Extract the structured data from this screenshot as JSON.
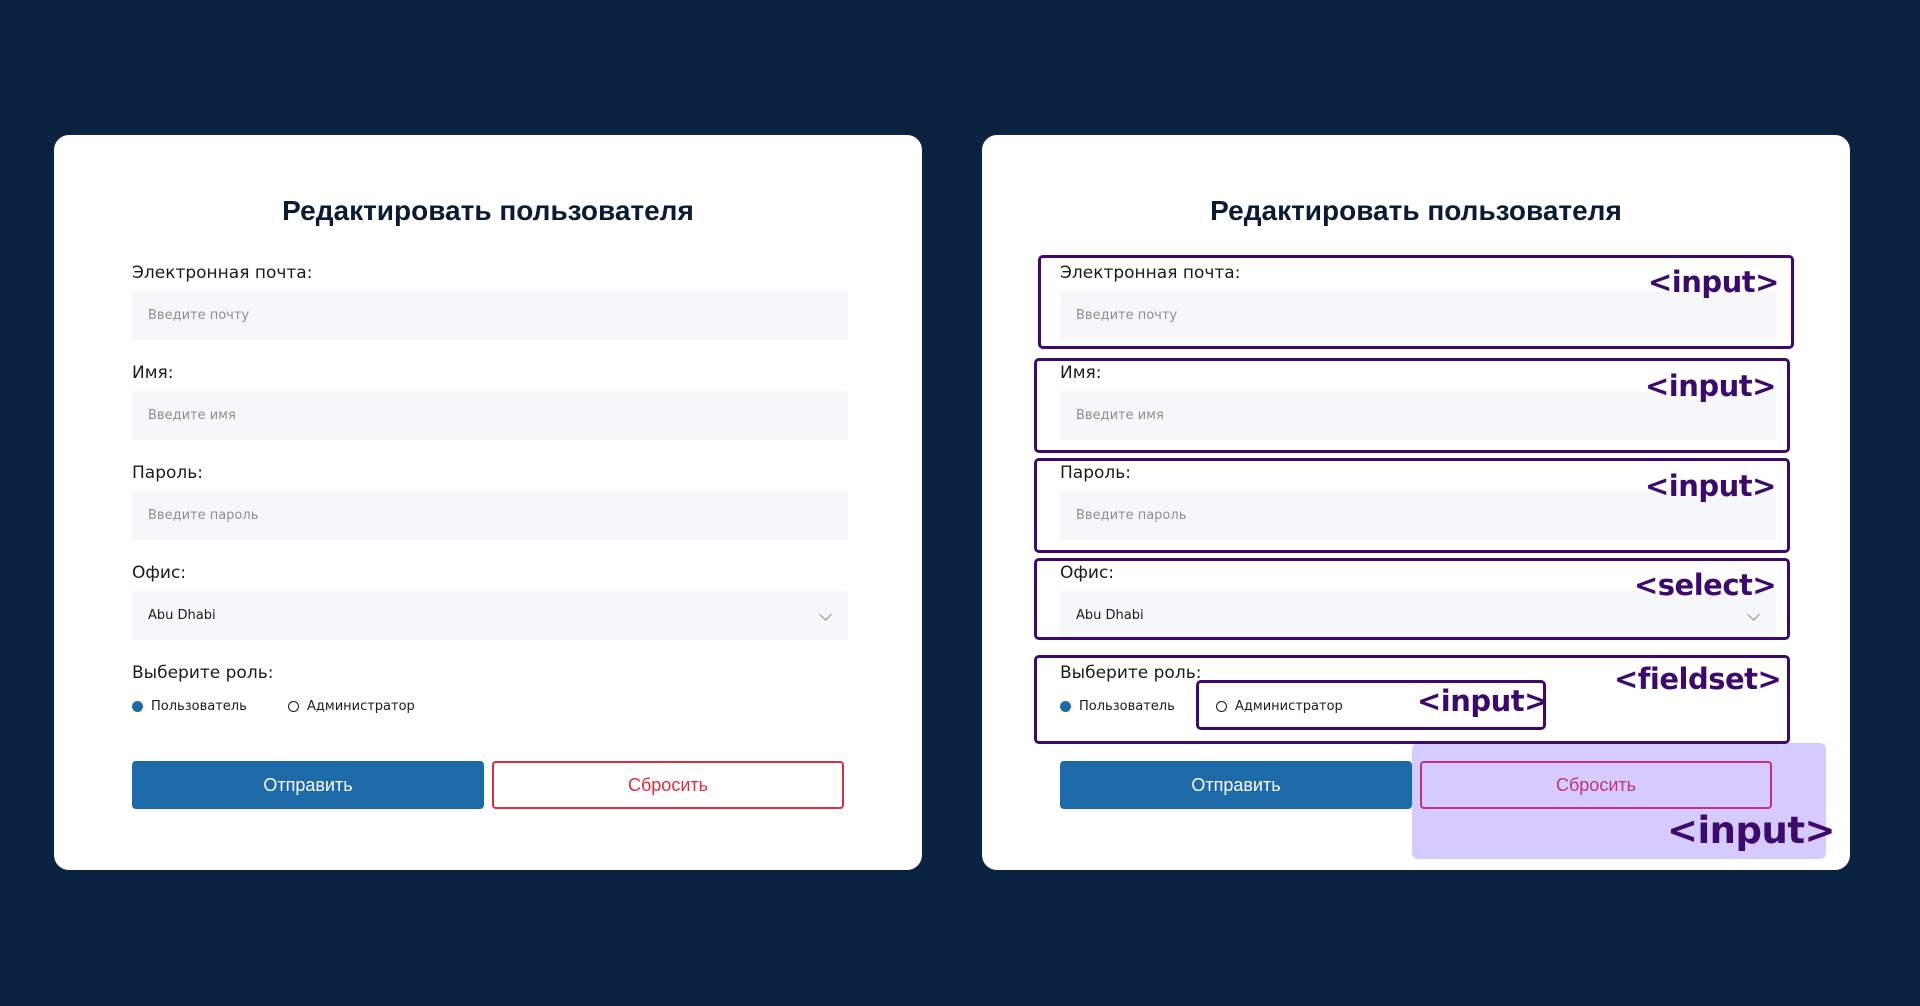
{
  "form": {
    "title": "Редактировать пользователя",
    "email": {
      "label": "Электронная почта:",
      "placeholder": "Введите почту"
    },
    "name": {
      "label": "Имя:",
      "placeholder": "Введите имя"
    },
    "password": {
      "label": "Пароль:",
      "placeholder": "Введите пароль"
    },
    "office": {
      "label": "Офис:",
      "value": "Abu Dhabi"
    },
    "role": {
      "label": "Выберите роль:",
      "options": [
        {
          "label": "Пользователь",
          "checked": true
        },
        {
          "label": "Администратор",
          "checked": false
        }
      ]
    },
    "buttons": {
      "submit": "Отправить",
      "reset": "Сбросить"
    }
  },
  "annotations": {
    "input": "<input>",
    "select": "<select>",
    "fieldset": "<fieldset>"
  },
  "colors": {
    "background": "#0b2341",
    "primary": "#1d6aa8",
    "danger": "#e02a3f",
    "annotation": "#3c0a6b",
    "highlight": "#b4a0ff"
  }
}
